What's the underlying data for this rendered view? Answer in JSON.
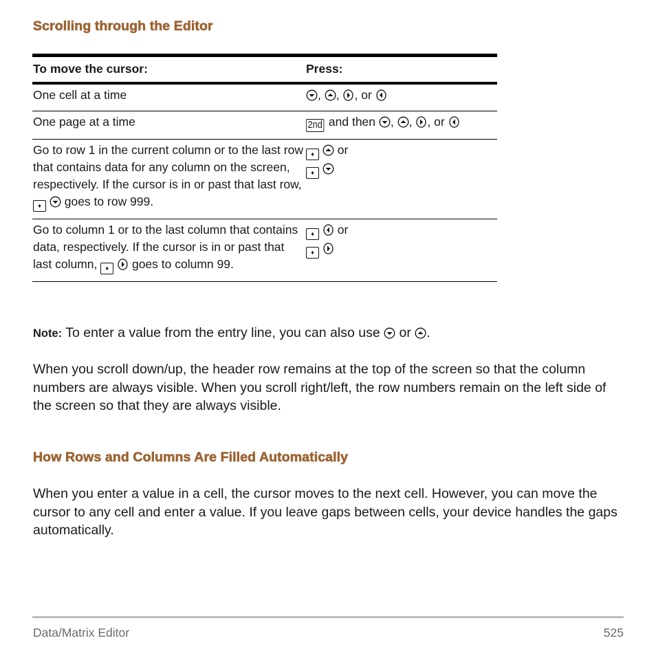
{
  "section1": {
    "title": "Scrolling through the Editor"
  },
  "table": {
    "headers": [
      "To move the cursor:",
      "Press:"
    ],
    "rows": [
      {
        "action": "One cell at a time",
        "keys_text": [
          ", ",
          ", ",
          ", or "
        ],
        "icons": [
          "down-arrow-icon",
          "up-arrow-icon",
          "right-arrow-icon",
          "left-arrow-icon"
        ]
      },
      {
        "action": "One page at a time",
        "key_label": "2nd",
        "and_then": " and then ",
        "keys_text": [
          ", ",
          ", ",
          ", or "
        ],
        "icons": [
          "2nd-key-icon",
          "down-arrow-icon",
          "up-arrow-icon",
          "right-arrow-icon",
          "left-arrow-icon"
        ]
      },
      {
        "action_parts": [
          "Go to row 1 in the current column or to the last row that contains data for any column on the screen, respectively. If the cursor is in or past that last row, ",
          " goes to row 999."
        ],
        "press_or": " or",
        "icons": [
          "diamond-key-icon",
          "up-arrow-icon",
          "diamond-key-icon",
          "down-arrow-icon"
        ]
      },
      {
        "action_parts": [
          "Go to column 1 or to the last column that contains data, respectively. If the cursor is in or past that last column, ",
          " goes to column 99."
        ],
        "press_or": " or",
        "icons": [
          "diamond-key-icon",
          "left-arrow-icon",
          "diamond-key-icon",
          "right-arrow-icon"
        ]
      }
    ]
  },
  "note": {
    "label": "Note:",
    "text": " To enter a value from the entry line, you can also use ",
    "or": " or ",
    "end": "."
  },
  "paragraph1": "When you scroll down/up, the header row remains at the top of the screen so that the column numbers are always visible. When you scroll right/left, the row numbers remain on the left side of the screen so that they are always visible.",
  "section2": {
    "title": "How Rows and Columns Are Filled Automatically"
  },
  "paragraph2": "When you enter a value in a cell, the cursor moves to the next cell. However, you can move the cursor to any cell and enter a value. If you leave gaps between cells, your device handles the gaps automatically.",
  "footer": {
    "section": "Data/Matrix Editor",
    "page": "525"
  },
  "colors": {
    "heading": "#9b6433",
    "footer_text": "#6b6b6b",
    "footer_rule": "#bdbdbd"
  }
}
